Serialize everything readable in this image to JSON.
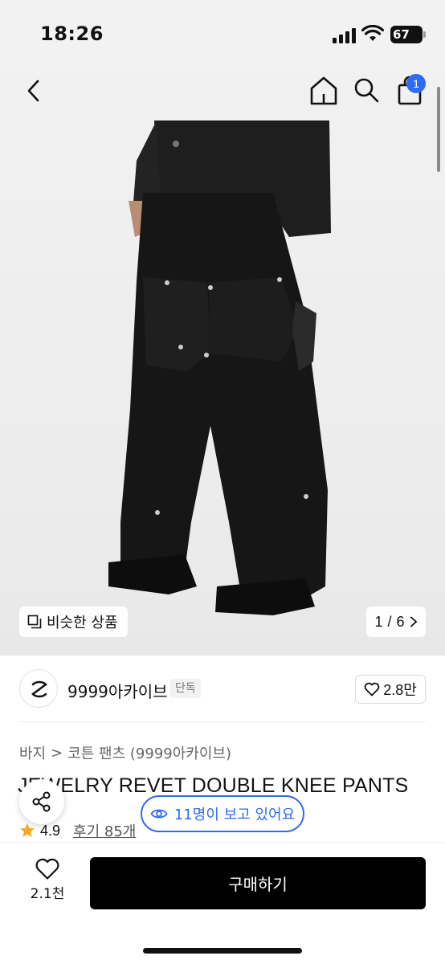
{
  "status_bar": {
    "time": "18:26",
    "battery": "67"
  },
  "nav": {
    "cart_badge": "1",
    "icons": [
      "back-arrow-icon",
      "home-icon",
      "search-icon",
      "shopping-bag-icon"
    ]
  },
  "gallery": {
    "similar_label": "비슷한 상품",
    "page_current": "1",
    "page_total": "6",
    "page_separator": "/"
  },
  "seller": {
    "name": "9999아카이브",
    "tag": "단독",
    "likes": "2.8만"
  },
  "breadcrumb": {
    "category": "바지",
    "separator": ">",
    "subcategory": "코튼 팬츠 (9999아카이브)"
  },
  "product": {
    "title": "JEWELRY REVET DOUBLE KNEE PANTS",
    "rating": "4.9",
    "reviews": "후기 85개"
  },
  "viewer_notice": "11명이 보고 있어요",
  "bottom": {
    "wish_count": "2.1천",
    "buy_label": "구매하기"
  },
  "colors": {
    "accent": "#2f6bf1",
    "buy_button": "#000000",
    "star": "#f5a623"
  }
}
